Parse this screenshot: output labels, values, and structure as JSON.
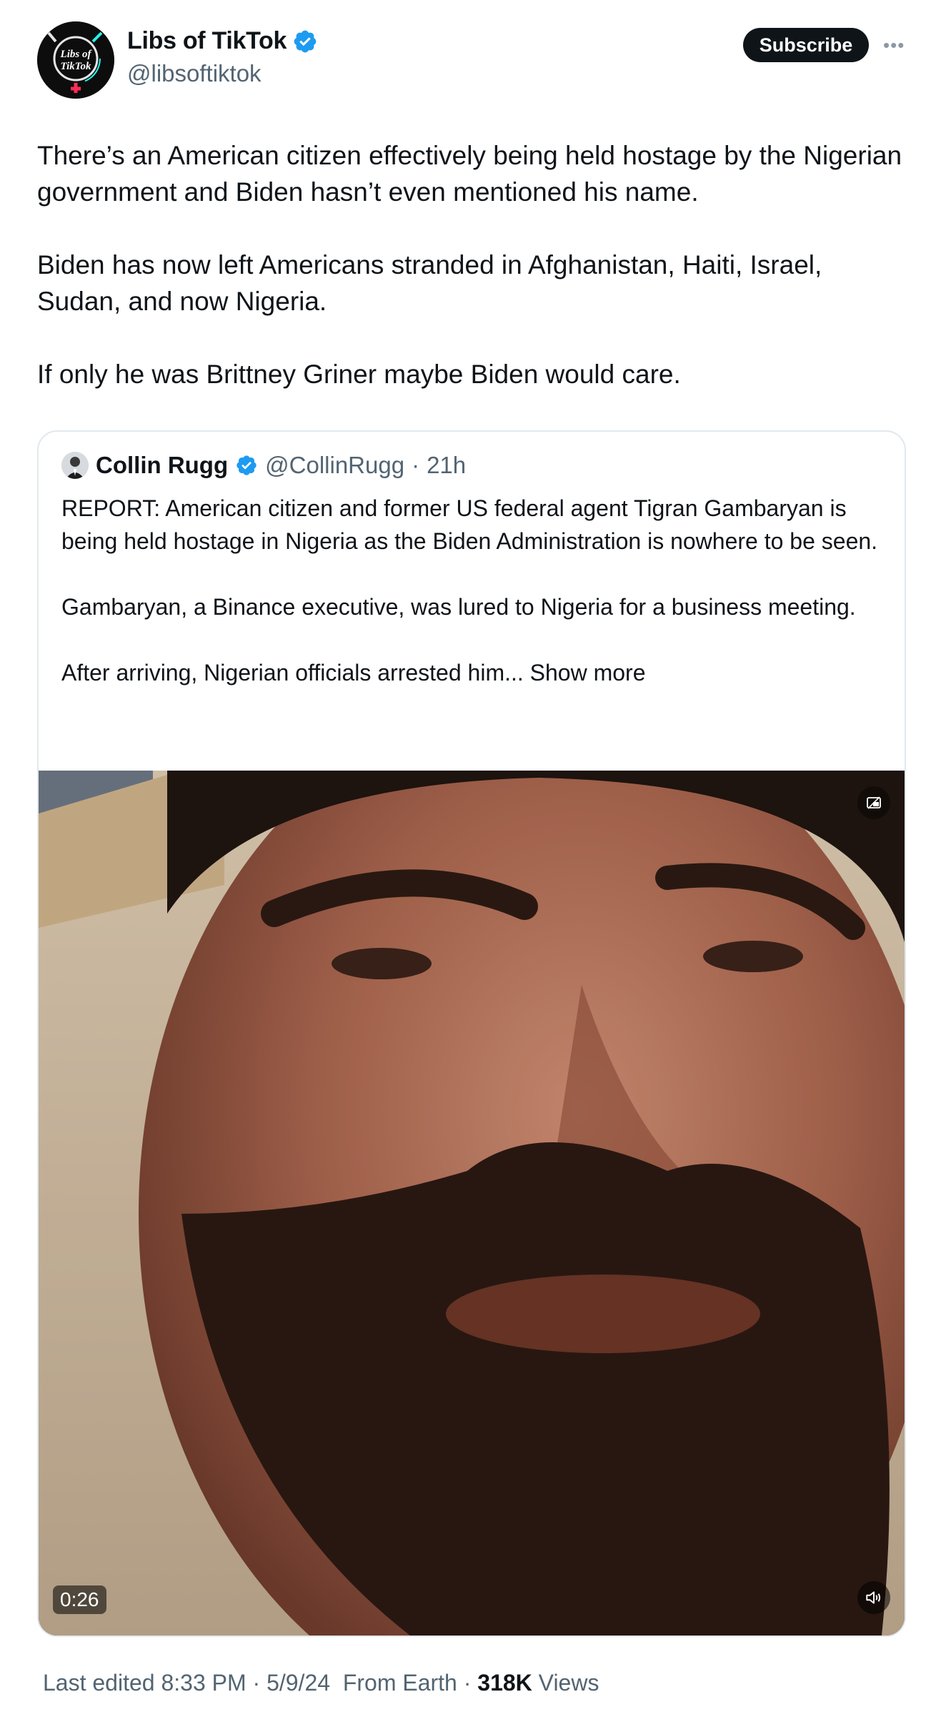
{
  "author": {
    "name": "Libs of TikTok",
    "handle": "@libsoftiktok",
    "avatar_text_line1": "Libs of",
    "avatar_text_line2": "TikTok",
    "verified": true
  },
  "actions": {
    "subscribe_label": "Subscribe",
    "more_icon": "more-dots-icon"
  },
  "tweet": {
    "paragraphs": [
      "There’s an American citizen effectively being held hostage by the Nigerian government and Biden hasn’t even mentioned his name.",
      "Biden has now left Americans stranded in Afghanistan, Haiti, Israel, Sudan, and now Nigeria.",
      "If only he was Brittney Griner maybe Biden would care."
    ]
  },
  "quoted_tweet": {
    "name": "Collin Rugg",
    "handle": "@CollinRugg",
    "separator": "·",
    "time": "21h",
    "paragraphs": [
      "REPORT: American citizen and former US federal agent Tigran Gambaryan is being held hostage in Nigeria as the Biden Administration is nowhere to be seen.",
      "Gambaryan, a Binance executive, was lured to Nigeria for a business meeting.",
      "After arriving, Nigerian officials arrested him..."
    ],
    "show_more": "Show more",
    "video": {
      "duration": "0:26",
      "mute_icon": "speaker-muted-icon",
      "pip_icon": "picture-in-picture-icon"
    }
  },
  "meta": {
    "edited_prefix": "Last edited",
    "time": "8:33 PM",
    "sep1": "·",
    "date": "5/9/24",
    "source": "From Earth",
    "sep2": "·",
    "views_count": "318K",
    "views_label": "Views"
  },
  "colors": {
    "verified_blue": "#1d9bf0",
    "secondary_text": "#536471",
    "primary_text": "#0f1419"
  }
}
